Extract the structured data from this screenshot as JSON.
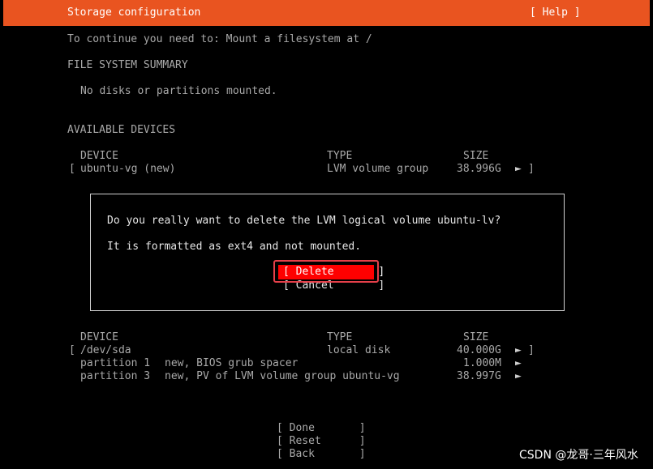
{
  "header": {
    "title": "Storage configuration",
    "help_label": "[ Help ]"
  },
  "instruction": "To continue you need to: Mount a filesystem at /",
  "fs_summary": {
    "heading": "FILE SYSTEM SUMMARY",
    "empty_text": "No disks or partitions mounted."
  },
  "available": {
    "heading": "AVAILABLE DEVICES",
    "columns": {
      "device": "DEVICE",
      "type": "TYPE",
      "size": "SIZE"
    },
    "vg_row": {
      "bracket_open": "[",
      "name": "ubuntu-vg (new)",
      "type": "LVM volume group",
      "size": "38.996G",
      "arrow": "►",
      "bracket_close": "]"
    }
  },
  "dialog": {
    "question": "Do you really want to delete the LVM logical volume ubuntu-lv?",
    "info": "It is formatted as ext4 and not mounted.",
    "delete_label": "[ Delete       ]",
    "cancel_label": "[ Cancel       ]"
  },
  "used": {
    "columns": {
      "device": "DEVICE",
      "type": "TYPE",
      "size": "SIZE"
    },
    "disk_row": {
      "bracket_open": "[",
      "name": "/dev/sda",
      "type": "local disk",
      "size": "40.000G",
      "arrow": "►",
      "bracket_close": "]"
    },
    "partitions": [
      {
        "name": "partition 1",
        "desc": "new, BIOS grub spacer",
        "size": "1.000M",
        "arrow": "►"
      },
      {
        "name": "partition 3",
        "desc": "new, PV of LVM volume group ubuntu-vg",
        "size": "38.997G",
        "arrow": "►"
      }
    ]
  },
  "footer_buttons": {
    "done": "[ Done       ]",
    "reset": "[ Reset      ]",
    "back": "[ Back       ]"
  },
  "watermark": "CSDN @龙哥·三年风水",
  "colors": {
    "header_bg": "#e95420",
    "delete_bg": "#ff0000",
    "highlight_outline": "#e5404a"
  }
}
